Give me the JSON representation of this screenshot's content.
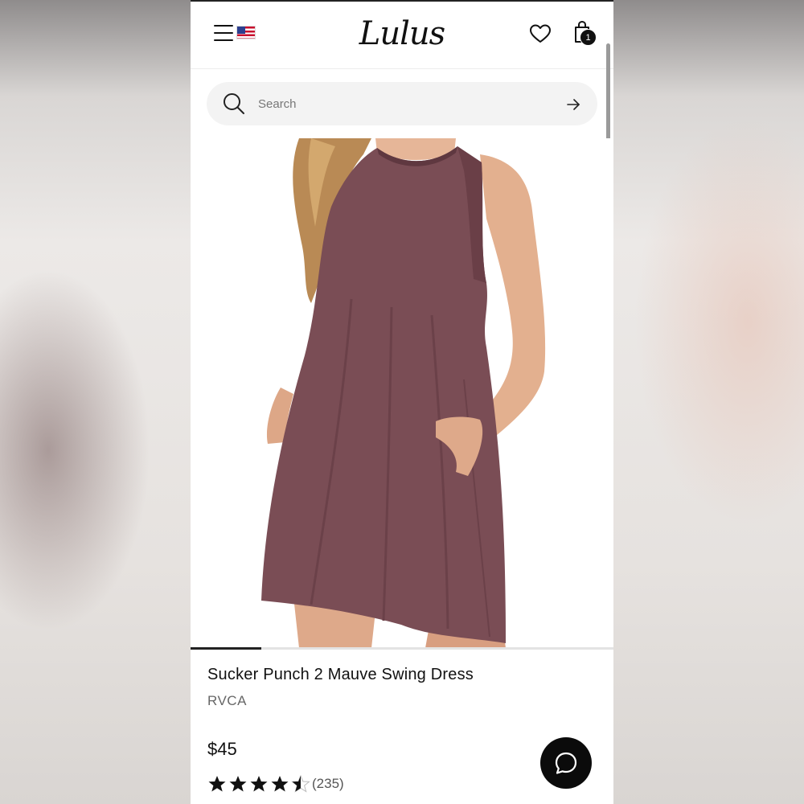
{
  "header": {
    "logo": "Lulus",
    "cart_count": "1"
  },
  "search": {
    "placeholder": "Search"
  },
  "product": {
    "name": "Sucker Punch 2 Mauve Swing Dress",
    "brand": "RVCA",
    "price": "$45",
    "rating": 4.5,
    "review_count": "(235)"
  },
  "carousel": {
    "current_slide": 1
  },
  "colors": {
    "dress": "#7a4d55",
    "text": "#111111",
    "chat_button": "#0b0b0b"
  },
  "icons": {
    "menu": "hamburger-menu-icon",
    "flag": "us-flag-icon",
    "wishlist": "heart-icon",
    "cart": "shopping-bag-icon",
    "search": "search-icon",
    "go": "arrow-right-icon",
    "chat": "chat-bubble-icon"
  }
}
